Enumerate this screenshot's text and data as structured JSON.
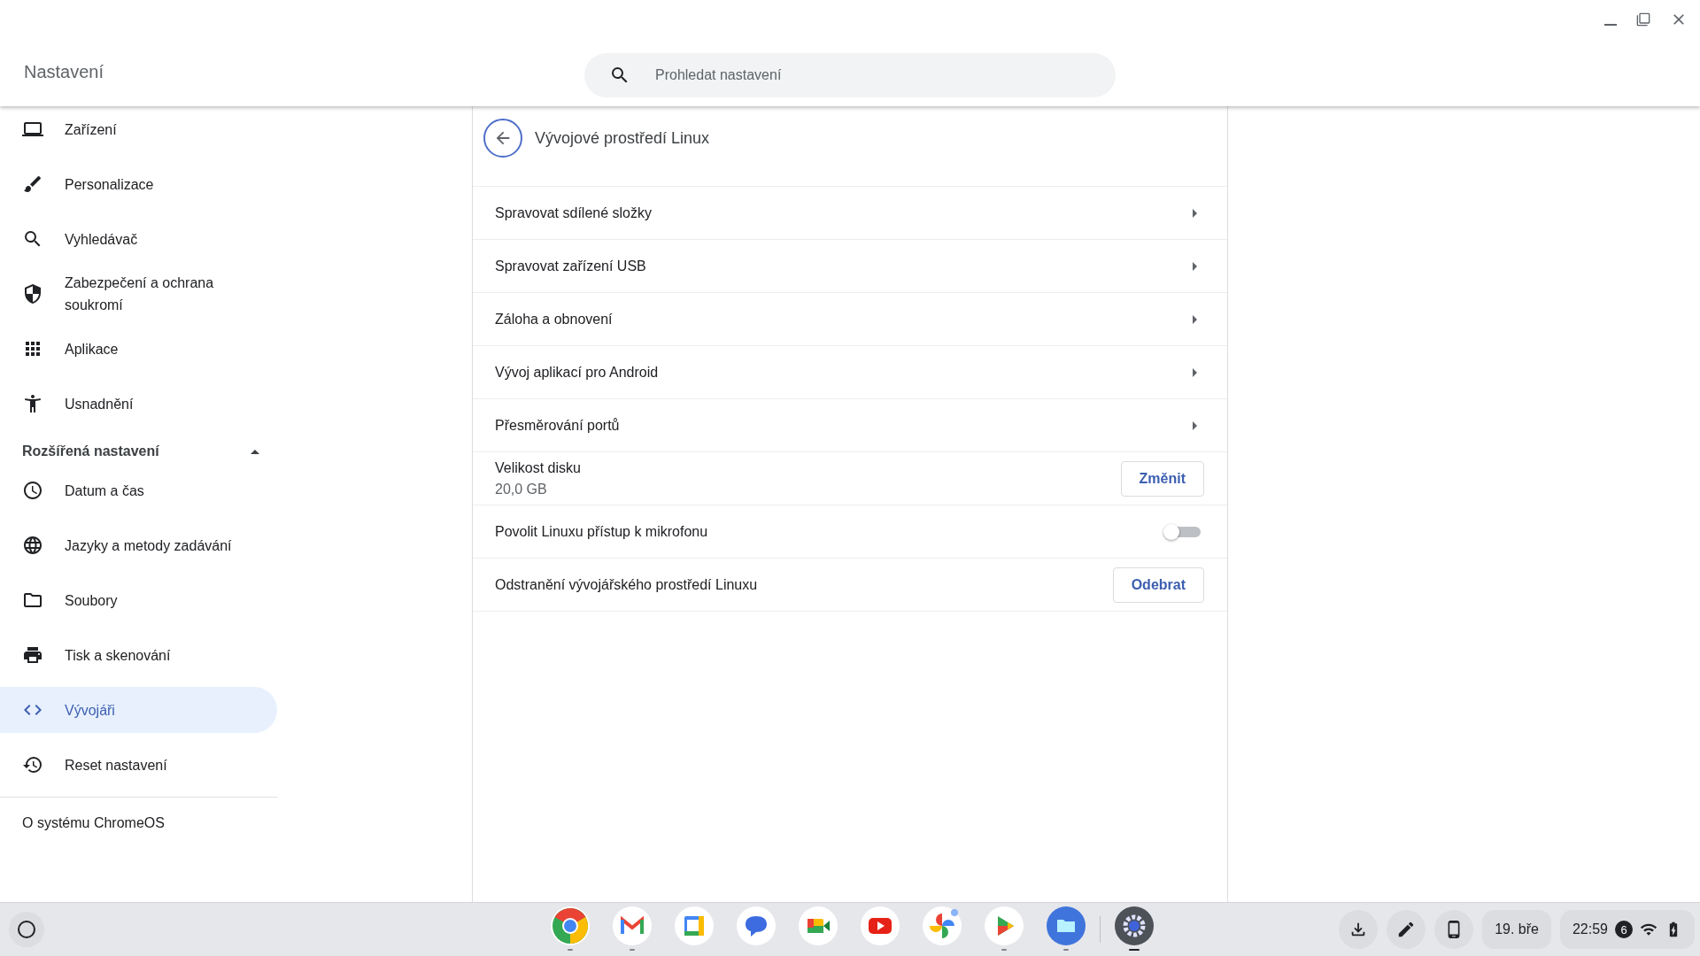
{
  "app_title": "Nastavení",
  "search": {
    "placeholder": "Prohledat nastavení"
  },
  "sidebar": {
    "items": [
      {
        "label": "Zařízení",
        "selected": false
      },
      {
        "label": "Personalizace",
        "selected": false
      },
      {
        "label": "Vyhledávač",
        "selected": false
      },
      {
        "label": "Zabezpečení a ochrana soukromí",
        "selected": false
      },
      {
        "label": "Aplikace",
        "selected": false
      },
      {
        "label": "Usnadnění",
        "selected": false
      }
    ],
    "advanced": {
      "label": "Rozšířená nastavení",
      "expanded": true,
      "items": [
        {
          "label": "Datum a čas",
          "selected": false
        },
        {
          "label": "Jazyky a metody zadávání",
          "selected": false
        },
        {
          "label": "Soubory",
          "selected": false
        },
        {
          "label": "Tisk a skenování",
          "selected": false
        },
        {
          "label": "Vývojáři",
          "selected": true
        },
        {
          "label": "Reset nastavení",
          "selected": false
        }
      ]
    },
    "about": "O systému ChromeOS"
  },
  "page": {
    "title": "Vývojové prostředí Linux",
    "rows": [
      {
        "kind": "link",
        "label": "Spravovat sdílené složky"
      },
      {
        "kind": "link",
        "label": "Spravovat zařízení USB"
      },
      {
        "kind": "link",
        "label": "Záloha a obnovení"
      },
      {
        "kind": "link",
        "label": "Vývoj aplikací pro Android"
      },
      {
        "kind": "link",
        "label": "Přesměrování portů"
      },
      {
        "kind": "button",
        "label": "Velikost disku",
        "sublabel": "20,0 GB",
        "button": "Změnit"
      },
      {
        "kind": "toggle",
        "label": "Povolit Linuxu přístup k mikrofonu",
        "on": false
      },
      {
        "kind": "button",
        "label": "Odstranění vývojářského prostředí Linuxu",
        "button": "Odebrat"
      }
    ]
  },
  "shelf": {
    "apps": [
      {
        "running": true,
        "active": false
      },
      {
        "running": true,
        "active": false
      },
      {
        "running": false,
        "active": false
      },
      {
        "running": false,
        "active": false
      },
      {
        "running": false,
        "active": false
      },
      {
        "running": false,
        "active": false
      },
      {
        "running": false,
        "active": false
      },
      {
        "running": true,
        "active": false
      },
      {
        "running": true,
        "active": false
      },
      {
        "running": true,
        "active": true
      }
    ],
    "date": "19. bře",
    "time": "22:59",
    "notifications": "6"
  }
}
